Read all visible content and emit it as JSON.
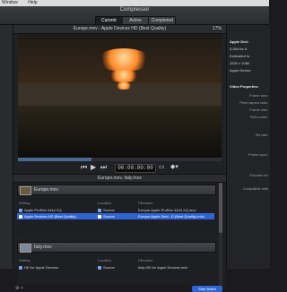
{
  "menubar": {
    "items": [
      "Window",
      "Help"
    ]
  },
  "app": {
    "title": "Compressor"
  },
  "tabs": [
    "Current",
    "Active",
    "Completed"
  ],
  "viewer": {
    "title": "Europe.mov - Apple Devices HD (Best Quality)",
    "zoom": "17%",
    "timecode": "00:00:00:00",
    "progress": 0.36
  },
  "batch": {
    "title": "Europe.mov, Italy.mov"
  },
  "columns": {
    "setting": "Setting",
    "location": "Location",
    "filename": "Filename"
  },
  "jobs": [
    {
      "name": "Europe.mov",
      "outputs": [
        {
          "setting": "Apple ProRes 4444 XQ",
          "location": "Source",
          "filename": "Europe-Apple ProRes 4444 XQ.mov",
          "selected": false
        },
        {
          "setting": "Apple Devices HD (Best Quality)",
          "location": "Source",
          "filename": "Europe-Apple Devi...D (Best Quality).m4v",
          "selected": true
        }
      ]
    },
    {
      "name": "Italy.mov",
      "outputs": [
        {
          "setting": "HD for Apple Devices",
          "location": "Source",
          "filename": "Italy-HD for Apple Devices.m4v",
          "selected": false
        }
      ]
    }
  ],
  "inspector": {
    "title": "Apple Devi",
    "lines": [
      "4,284 for A",
      "Estimated fo",
      "1920 x 1080",
      "Apple Device"
    ],
    "video_props": "Video Properties",
    "labels": [
      "Frame size:",
      "Pixel aspect ratio:",
      "Frame rate:",
      "Field order:",
      "Bit rate:",
      "Frame sync:",
      "Encoder for",
      "Compatible with"
    ]
  },
  "footer": {
    "start": "Start Batch"
  }
}
